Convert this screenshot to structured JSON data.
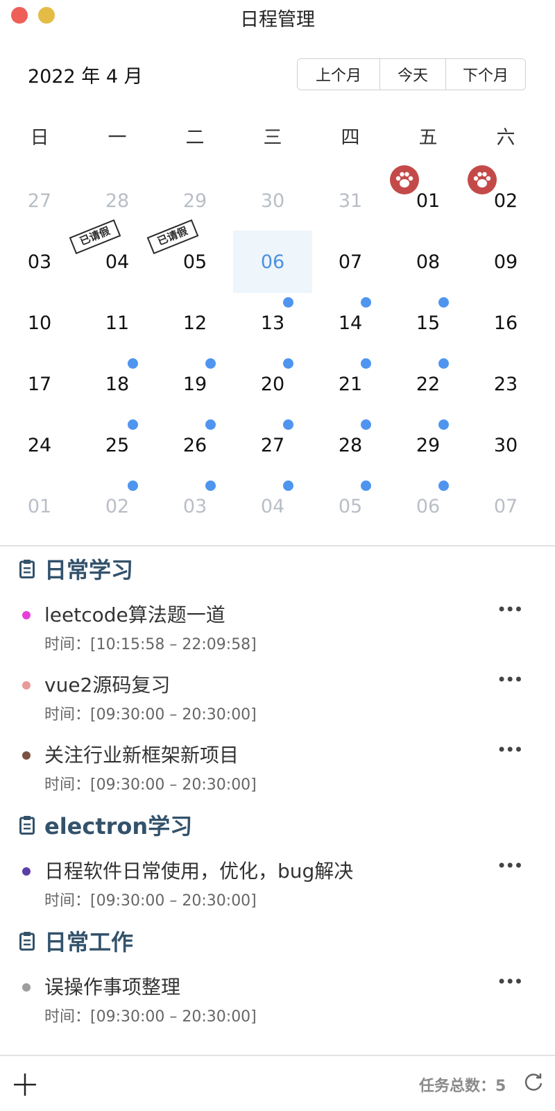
{
  "window": {
    "title": "日程管理"
  },
  "header": {
    "month_label": "2022 年 4 月",
    "nav": {
      "prev": "上个月",
      "today": "今天",
      "next": "下个月"
    }
  },
  "calendar": {
    "weekdays": [
      "日",
      "一",
      "二",
      "三",
      "四",
      "五",
      "六"
    ],
    "today": "06",
    "accent_color": "#4f95f0",
    "weeks": [
      [
        {
          "d": "27",
          "other": true
        },
        {
          "d": "28",
          "other": true
        },
        {
          "d": "29",
          "other": true
        },
        {
          "d": "30",
          "other": true
        },
        {
          "d": "31",
          "other": true
        },
        {
          "d": "01",
          "paw": true
        },
        {
          "d": "02",
          "paw": true
        }
      ],
      [
        {
          "d": "03"
        },
        {
          "d": "04",
          "stamp": true
        },
        {
          "d": "05",
          "stamp": true
        },
        {
          "d": "06",
          "dot": true,
          "today": true
        },
        {
          "d": "07",
          "dot": true
        },
        {
          "d": "08",
          "dot": true
        },
        {
          "d": "09"
        }
      ],
      [
        {
          "d": "10"
        },
        {
          "d": "11",
          "dot": true
        },
        {
          "d": "12",
          "dot": true
        },
        {
          "d": "13",
          "dot": true
        },
        {
          "d": "14",
          "dot": true
        },
        {
          "d": "15",
          "dot": true
        },
        {
          "d": "16"
        }
      ],
      [
        {
          "d": "17"
        },
        {
          "d": "18",
          "dot": true
        },
        {
          "d": "19",
          "dot": true
        },
        {
          "d": "20",
          "dot": true
        },
        {
          "d": "21",
          "dot": true
        },
        {
          "d": "22",
          "dot": true
        },
        {
          "d": "23"
        }
      ],
      [
        {
          "d": "24"
        },
        {
          "d": "25",
          "dot": true
        },
        {
          "d": "26",
          "dot": true
        },
        {
          "d": "27",
          "dot": true
        },
        {
          "d": "28",
          "dot": true
        },
        {
          "d": "29",
          "dot": true
        },
        {
          "d": "30"
        }
      ],
      [
        {
          "d": "01",
          "other": true
        },
        {
          "d": "02",
          "other": true
        },
        {
          "d": "03",
          "other": true
        },
        {
          "d": "04",
          "other": true
        },
        {
          "d": "05",
          "other": true
        },
        {
          "d": "06",
          "other": true
        },
        {
          "d": "07",
          "other": true
        }
      ]
    ],
    "stamp_text": "已请假"
  },
  "groups": [
    {
      "title": "日常学习",
      "tasks": [
        {
          "title": "leetcode算法题一道",
          "time": "时间：[10:15:58 – 22:09:58]",
          "color": "#e63fd9"
        },
        {
          "title": "vue2源码复习",
          "time": "时间：[09:30:00 – 20:30:00]",
          "color": "#e89a9a"
        },
        {
          "title": "关注行业新框架新项目",
          "time": "时间：[09:30:00 – 20:30:00]",
          "color": "#7a5244"
        }
      ]
    },
    {
      "title": "electron学习",
      "tasks": [
        {
          "title": "日程软件日常使用，优化，bug解决",
          "time": "时间：[09:30:00 – 20:30:00]",
          "color": "#5b3fa8"
        }
      ]
    },
    {
      "title": "日常工作",
      "tasks": [
        {
          "title": "误操作事项整理",
          "time": "时间：[09:30:00 – 20:30:00]",
          "color": "#9e9e9e"
        }
      ]
    }
  ],
  "more_glyph": "•••",
  "footer": {
    "task_count": "任务总数：5"
  }
}
